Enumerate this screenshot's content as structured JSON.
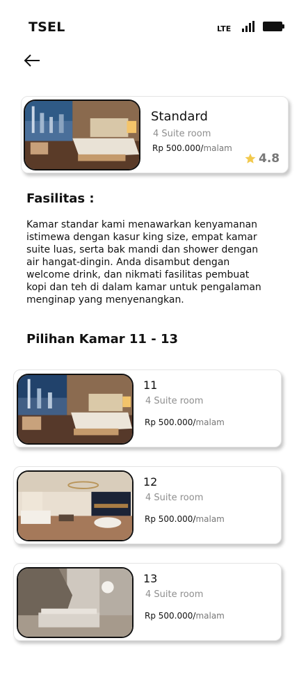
{
  "status_bar": {
    "carrier": "TSEL",
    "network": "LTE",
    "signal_icon": "signal-bars-icon",
    "battery_icon": "battery-full-icon"
  },
  "nav": {
    "back_icon": "arrow-left-icon"
  },
  "featured": {
    "title": "Standard",
    "subtitle": "4 Suite room",
    "price": "Rp 500.000/",
    "unit": "malam",
    "rating": "4.8",
    "rating_icon": "star-icon",
    "star_color": "#F2C94C"
  },
  "facilities": {
    "heading": "Fasilitas :",
    "description": "Kamar standar kami menawarkan kenyamanan istimewa dengan kasur king size, empat kamar suite luas, serta bak mandi dan shower dengan air hangat-dingin. Anda disambut dengan welcome drink, dan nikmati fasilitas pembuat kopi dan teh di dalam kamar untuk pengalaman menginap yang menyenangkan."
  },
  "rooms": {
    "heading": "Pilihan Kamar 11 - 13",
    "items": [
      {
        "number": "11",
        "subtitle": "4 Suite room",
        "price": "Rp 500.000/",
        "unit": "malam"
      },
      {
        "number": "12",
        "subtitle": "4 Suite room",
        "price": "Rp 500.000/",
        "unit": "malam"
      },
      {
        "number": "13",
        "subtitle": "4 Suite room",
        "price": "Rp 500.000/",
        "unit": "malam"
      }
    ]
  }
}
